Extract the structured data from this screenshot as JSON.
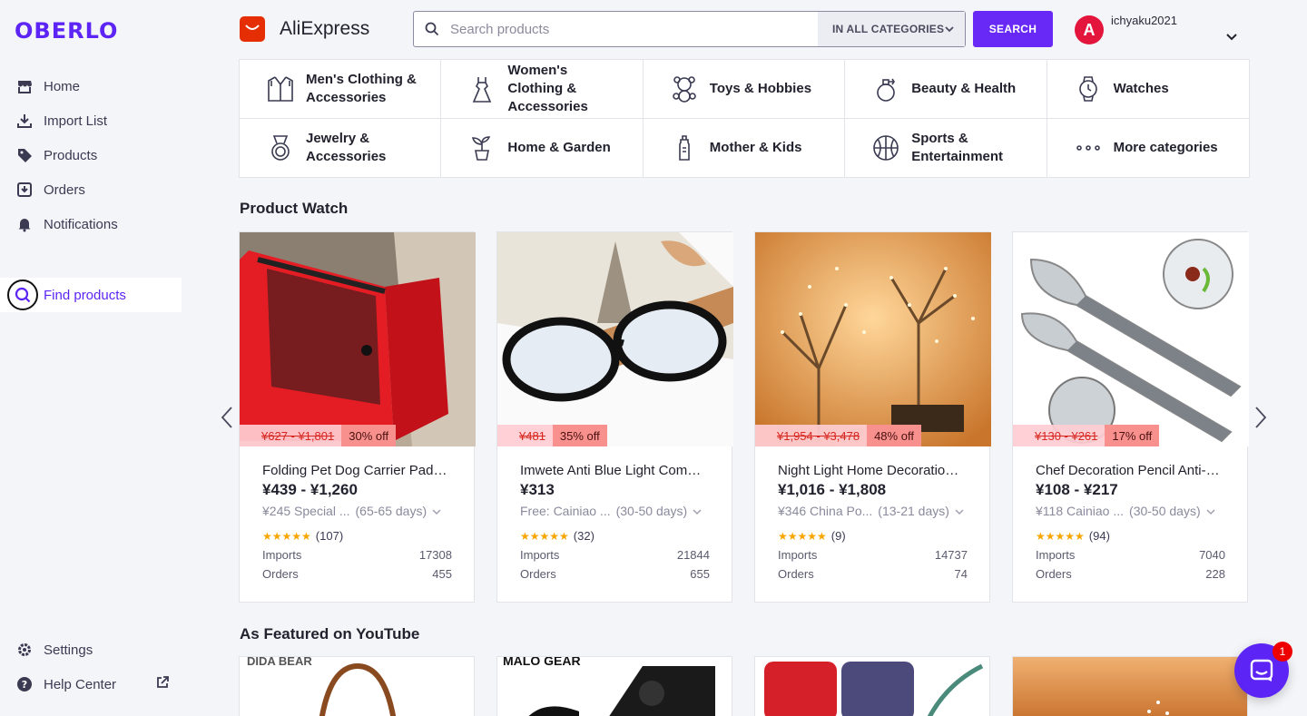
{
  "brand": {
    "logo_text": "OBERLO",
    "accent": "#5d25f5"
  },
  "sidebar": {
    "items": [
      {
        "label": "Home",
        "icon": "store-icon"
      },
      {
        "label": "Import List",
        "icon": "download-icon"
      },
      {
        "label": "Products",
        "icon": "tag-icon"
      },
      {
        "label": "Orders",
        "icon": "inbox-download-icon"
      },
      {
        "label": "Notifications",
        "icon": "bell-icon"
      },
      {
        "label": "Find products",
        "icon": "search-icon",
        "active": true
      }
    ],
    "bottom_items": [
      {
        "label": "Settings",
        "icon": "gear-icon"
      },
      {
        "label": "Help Center",
        "icon": "help-icon"
      }
    ]
  },
  "header": {
    "source_name": "AliExpress",
    "search_placeholder": "Search products",
    "category_select": "IN ALL CATEGORIES",
    "search_button": "SEARCH",
    "avatar_letter": "A",
    "username": "ichyaku2021"
  },
  "categories": [
    {
      "label": "Men's Clothing & Accessories",
      "icon": "shirt-icon"
    },
    {
      "label": "Women's Clothing & Accessories",
      "icon": "dress-icon"
    },
    {
      "label": "Toys & Hobbies",
      "icon": "teddy-bear-icon"
    },
    {
      "label": "Beauty & Health",
      "icon": "perfume-icon"
    },
    {
      "label": "Watches",
      "icon": "watch-icon"
    },
    {
      "label": "Jewelry & Accessories",
      "icon": "medal-ring-icon"
    },
    {
      "label": "Home & Garden",
      "icon": "plant-icon"
    },
    {
      "label": "Mother & Kids",
      "icon": "baby-bottle-icon"
    },
    {
      "label": "Sports & Entertainment",
      "icon": "basketball-icon"
    },
    {
      "label": "More categories",
      "icon": "more-dots-icon"
    }
  ],
  "product_watch": {
    "title": "Product Watch",
    "products": [
      {
        "title": "Folding Pet Dog Carrier Pad Waterproof",
        "price": "¥439 - ¥1,260",
        "old_price": "¥627 - ¥1,801",
        "discount": "30% off",
        "shipping": "¥245 Special ...",
        "shipping_days": "(65-65 days)",
        "reviews": "(107)",
        "imports_label": "Imports",
        "imports": "17308",
        "orders_label": "Orders",
        "orders": "455"
      },
      {
        "title": "Imwete Anti Blue Light Computer Glasses",
        "price": "¥313",
        "old_price": "¥481",
        "discount": "35% off",
        "shipping": "Free: Cainiao ...",
        "shipping_days": "(30-50 days)",
        "reviews": "(32)",
        "imports_label": "Imports",
        "imports": "21844",
        "orders_label": "Orders",
        "orders": "655"
      },
      {
        "title": "Night Light Home Decoration Tree Lamp",
        "price": "¥1,016 - ¥1,808",
        "old_price": "¥1,954 - ¥3,478",
        "discount": "48% off",
        "shipping": "¥346 China Po...",
        "shipping_days": "(13-21 days)",
        "reviews": "(9)",
        "imports_label": "Imports",
        "imports": "14737",
        "orders_label": "Orders",
        "orders": "74"
      },
      {
        "title": "Chef Decoration Pencil Anti-spill Spoon",
        "price": "¥108 - ¥217",
        "old_price": "¥130 - ¥261",
        "discount": "17% off",
        "shipping": "¥118 Cainiao ...",
        "shipping_days": "(30-50 days)",
        "reviews": "(94)",
        "imports_label": "Imports",
        "imports": "7040",
        "orders_label": "Orders",
        "orders": "228"
      }
    ]
  },
  "featured": {
    "title": "As Featured on YouTube",
    "brands": [
      "DIDA BEAR",
      "MALO GEAR",
      "",
      ""
    ]
  },
  "chat": {
    "badge_count": "1"
  }
}
